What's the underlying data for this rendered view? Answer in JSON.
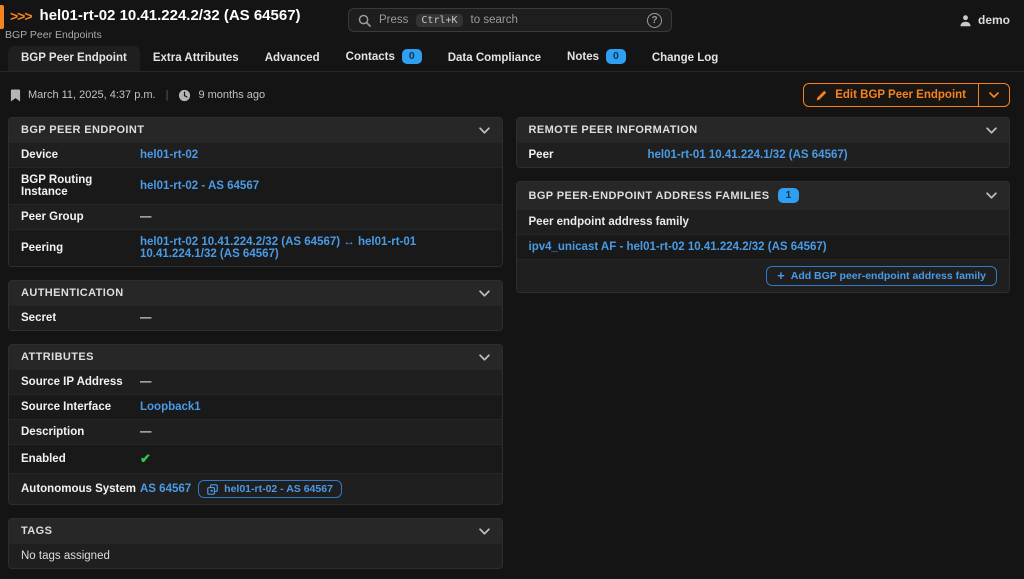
{
  "header": {
    "logo": ">>>",
    "title": "hel01-rt-02 10.41.224.2/32 (AS 64567)",
    "subtitle": "BGP Peer Endpoints",
    "search": {
      "prefix": "Press",
      "kbd": "Ctrl+K",
      "suffix": "to search",
      "help": "?"
    },
    "user": "demo"
  },
  "tabs": [
    {
      "label": "BGP Peer Endpoint",
      "active": true
    },
    {
      "label": "Extra Attributes"
    },
    {
      "label": "Advanced"
    },
    {
      "label": "Contacts",
      "badge": "0"
    },
    {
      "label": "Data Compliance"
    },
    {
      "label": "Notes",
      "badge": "0"
    },
    {
      "label": "Change Log"
    }
  ],
  "meta": {
    "date": "March 11, 2025, 4:37 p.m.",
    "ago": "9 months ago"
  },
  "actions": {
    "edit_label": "Edit BGP Peer Endpoint"
  },
  "icons": {
    "logo": "triple-chevron-right",
    "search": "magnifier",
    "help": "question-circle",
    "user": "person-silhouette",
    "date": "bookmark",
    "ago": "clock",
    "edit": "pencil",
    "dropdown": "chevron-down",
    "collapse": "chevron-down",
    "inherited": "copy",
    "add": "plus",
    "enabled": "check"
  },
  "colors": {
    "accent_orange": "#f5831f",
    "link_blue": "#4a9be6",
    "badge_blue": "#2f9ff2",
    "success_green": "#31c553"
  },
  "columns": {
    "left": [
      {
        "title": "BGP PEER ENDPOINT",
        "rows": [
          {
            "kind": "link",
            "label": "Device",
            "value": "hel01-rt-02"
          },
          {
            "kind": "link",
            "label": "BGP Routing Instance",
            "value": "hel01-rt-02 - AS 64567"
          },
          {
            "kind": "dash",
            "label": "Peer Group",
            "value": "—"
          },
          {
            "kind": "link",
            "label": "Peering",
            "value": "hel01-rt-02 10.41.224.2/32 (AS 64567) ↔ hel01-rt-01 10.41.224.1/32 (AS 64567)"
          }
        ]
      },
      {
        "title": "AUTHENTICATION",
        "rows": [
          {
            "kind": "dash",
            "label": "Secret",
            "value": "—"
          }
        ]
      },
      {
        "title": "ATTRIBUTES",
        "rows": [
          {
            "kind": "dash",
            "label": "Source IP Address",
            "value": "—"
          },
          {
            "kind": "link",
            "label": "Source Interface",
            "value": "Loopback1"
          },
          {
            "kind": "dash",
            "label": "Description",
            "value": "—"
          },
          {
            "kind": "check",
            "label": "Enabled",
            "value": "✔"
          },
          {
            "kind": "link_badge",
            "label": "Autonomous System",
            "value": "AS 64567",
            "badge": "hel01-rt-02 - AS 64567"
          }
        ]
      },
      {
        "title": "TAGS",
        "rows": [
          {
            "kind": "full",
            "value": "No tags assigned"
          }
        ]
      }
    ],
    "right": [
      {
        "title": "REMOTE PEER INFORMATION",
        "rows": [
          {
            "kind": "link",
            "label": "Peer",
            "value": "hel01-rt-01 10.41.224.1/32 (AS 64567)"
          }
        ]
      },
      {
        "title": "BGP PEER-ENDPOINT ADDRESS FAMILIES",
        "count": "1",
        "rows": [
          {
            "kind": "colheader",
            "value": "Peer endpoint address family"
          },
          {
            "kind": "full_link",
            "value": "ipv4_unicast AF - hel01-rt-02 10.41.224.2/32 (AS 64567)"
          },
          {
            "kind": "button",
            "value": "Add BGP peer-endpoint address family"
          }
        ]
      }
    ]
  }
}
